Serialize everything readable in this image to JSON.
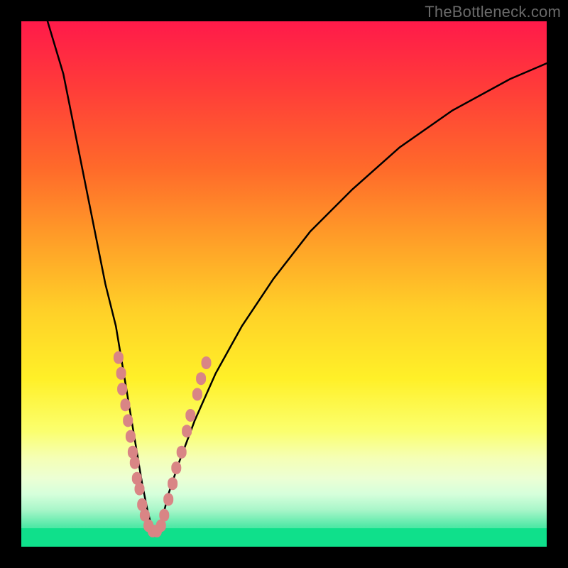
{
  "watermark": {
    "text": "TheBottleneck.com"
  },
  "colors": {
    "curve": "#000000",
    "marker_fill": "#d98585",
    "marker_stroke": "#c76e6e",
    "green_stripe": "#0fe08b",
    "frame_boundary": "#000000"
  },
  "chart_data": {
    "type": "line",
    "title": "",
    "xlabel": "",
    "ylabel": "",
    "xlim": [
      0,
      100
    ],
    "ylim": [
      0,
      100
    ],
    "grid": false,
    "legend": false,
    "annotations": [],
    "comment": "V-shaped bottleneck curve. Y is inverted visually (higher y = closer to top/red = worse). Curve minimum near x≈25. Pink markers are sample data points clustered around the valley/lower-left branch and lower-right branch.",
    "series": [
      {
        "name": "bottleneck-curve",
        "x": [
          5,
          8,
          10,
          12,
          14,
          16,
          18,
          19,
          20,
          21,
          22,
          23,
          24,
          25,
          26,
          27,
          28,
          30,
          33,
          37,
          42,
          48,
          55,
          63,
          72,
          82,
          93,
          100
        ],
        "y": [
          100,
          90,
          80,
          70,
          60,
          50,
          42,
          36,
          30,
          24,
          18,
          12,
          7,
          3,
          3,
          6,
          10,
          16,
          24,
          33,
          42,
          51,
          60,
          68,
          76,
          83,
          89,
          92
        ]
      }
    ],
    "markers": [
      {
        "x": 18.5,
        "y": 36
      },
      {
        "x": 19.0,
        "y": 33
      },
      {
        "x": 19.2,
        "y": 30
      },
      {
        "x": 19.8,
        "y": 27
      },
      {
        "x": 20.3,
        "y": 24
      },
      {
        "x": 20.8,
        "y": 21
      },
      {
        "x": 21.2,
        "y": 18
      },
      {
        "x": 21.6,
        "y": 16
      },
      {
        "x": 22.0,
        "y": 13
      },
      {
        "x": 22.5,
        "y": 11
      },
      {
        "x": 23.0,
        "y": 8
      },
      {
        "x": 23.5,
        "y": 6
      },
      {
        "x": 24.2,
        "y": 4
      },
      {
        "x": 25.0,
        "y": 3
      },
      {
        "x": 25.8,
        "y": 3
      },
      {
        "x": 26.6,
        "y": 4
      },
      {
        "x": 27.2,
        "y": 6
      },
      {
        "x": 28.0,
        "y": 9
      },
      {
        "x": 28.8,
        "y": 12
      },
      {
        "x": 29.5,
        "y": 15
      },
      {
        "x": 30.5,
        "y": 18
      },
      {
        "x": 31.5,
        "y": 22
      },
      {
        "x": 32.2,
        "y": 25
      },
      {
        "x": 33.5,
        "y": 29
      },
      {
        "x": 34.2,
        "y": 32
      },
      {
        "x": 35.2,
        "y": 35
      }
    ]
  }
}
